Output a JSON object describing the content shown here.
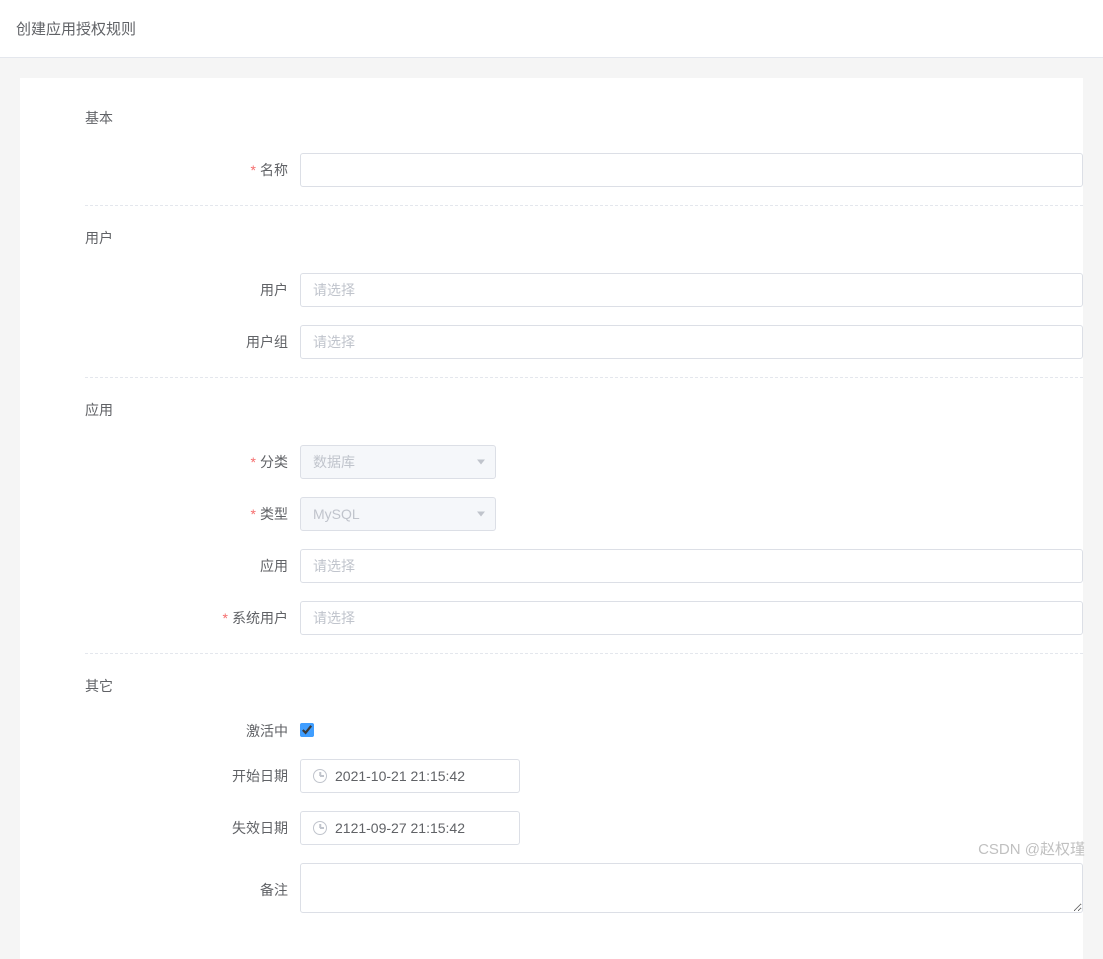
{
  "header": {
    "title": "创建应用授权规则"
  },
  "sections": {
    "basic": {
      "title": "基本",
      "fields": {
        "name": {
          "label": "名称",
          "required": true,
          "value": ""
        }
      }
    },
    "user": {
      "title": "用户",
      "fields": {
        "user": {
          "label": "用户",
          "placeholder": "请选择",
          "value": ""
        },
        "usergroup": {
          "label": "用户组",
          "placeholder": "请选择",
          "value": ""
        }
      }
    },
    "app": {
      "title": "应用",
      "fields": {
        "category": {
          "label": "分类",
          "required": true,
          "value": "数据库",
          "disabled": true
        },
        "type": {
          "label": "类型",
          "required": true,
          "value": "MySQL",
          "disabled": true
        },
        "application": {
          "label": "应用",
          "placeholder": "请选择",
          "value": ""
        },
        "system_user": {
          "label": "系统用户",
          "required": true,
          "placeholder": "请选择",
          "value": ""
        }
      }
    },
    "other": {
      "title": "其它",
      "fields": {
        "active": {
          "label": "激活中",
          "checked": true
        },
        "start_date": {
          "label": "开始日期",
          "value": "2021-10-21 21:15:42"
        },
        "expire_date": {
          "label": "失效日期",
          "value": "2121-09-27 21:15:42"
        },
        "remark": {
          "label": "备注",
          "value": ""
        }
      }
    }
  },
  "watermark": "CSDN @赵权瑾"
}
